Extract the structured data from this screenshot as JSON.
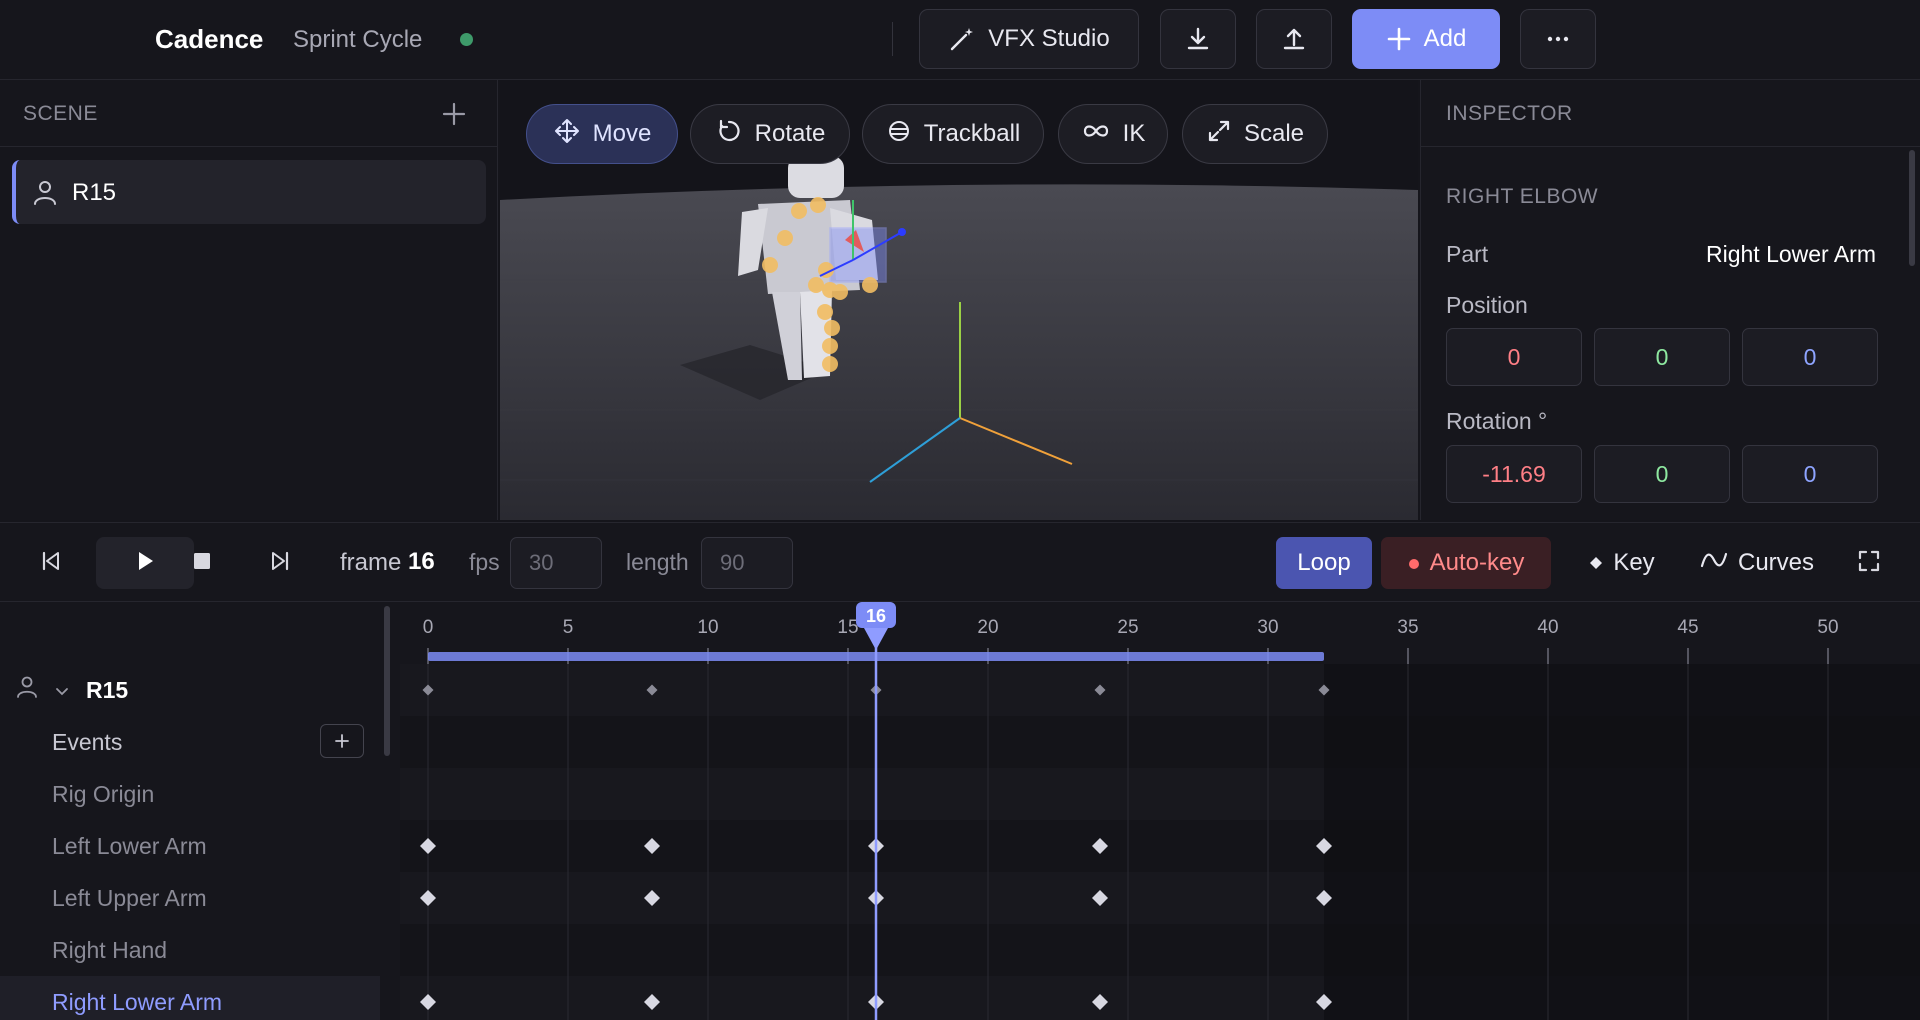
{
  "app": {
    "brand": "Cadence",
    "project": "Sprint Cycle",
    "status_color": "#3e9a6a"
  },
  "toolbar": {
    "vfx_label": "VFX Studio",
    "vfx_icon": "wand-icon",
    "download_icon": "download-icon",
    "upload_icon": "upload-icon",
    "add_label": "Add",
    "add_icon": "plus-icon",
    "more_icon": "more-icon",
    "accent_color": "#7d8cf6"
  },
  "scene": {
    "title": "SCENE",
    "add_icon": "plus-icon",
    "items": [
      {
        "label": "R15",
        "icon": "person-icon"
      }
    ]
  },
  "viewport": {
    "tools": [
      {
        "label": "Move",
        "icon": "move-icon",
        "active": true
      },
      {
        "label": "Rotate",
        "icon": "rotate-icon",
        "active": false
      },
      {
        "label": "Trackball",
        "icon": "trackball-icon",
        "active": false
      },
      {
        "label": "IK",
        "icon": "infinity-icon",
        "active": false
      },
      {
        "label": "Scale",
        "icon": "expand-icon",
        "active": false
      }
    ]
  },
  "inspector": {
    "title": "INSPECTOR",
    "section": "RIGHT ELBOW",
    "part_label": "Part",
    "part_value": "Right Lower Arm",
    "position_label": "Position",
    "position": [
      "0",
      "0",
      "0"
    ],
    "rotation_label": "Rotation °",
    "rotation": [
      "-11.69",
      "0",
      "0"
    ],
    "axis_colors": [
      "#ff7f86",
      "#8ee8a0",
      "#8ea4ff"
    ]
  },
  "transport": {
    "frame_label": "frame",
    "frame_value": "16",
    "fps_label": "fps",
    "fps_value": "30",
    "length_label": "length",
    "length_value": "90",
    "loop_label": "Loop",
    "autokey_label": "Auto-key",
    "key_label": "Key",
    "curves_label": "Curves"
  },
  "timeline": {
    "ruler_ticks": [
      "0",
      "5",
      "10",
      "15",
      "20",
      "25",
      "30",
      "35",
      "40",
      "45",
      "50"
    ],
    "current_frame": 16,
    "playhead_label": "16",
    "range_end_frame": 32,
    "keyframes": [
      0,
      8,
      16,
      24,
      32
    ],
    "tracks": [
      {
        "label": "R15",
        "kind": "root",
        "has_keys": true
      },
      {
        "label": "Events",
        "kind": "events",
        "has_keys": false
      },
      {
        "label": "Rig Origin",
        "kind": "bone",
        "has_keys": false
      },
      {
        "label": "Left Lower Arm",
        "kind": "bone",
        "has_keys": true
      },
      {
        "label": "Left Upper Arm",
        "kind": "bone",
        "has_keys": true
      },
      {
        "label": "Right Hand",
        "kind": "bone",
        "has_keys": false
      },
      {
        "label": "Right Lower Arm",
        "kind": "bone",
        "has_keys": true,
        "selected": true
      }
    ]
  }
}
